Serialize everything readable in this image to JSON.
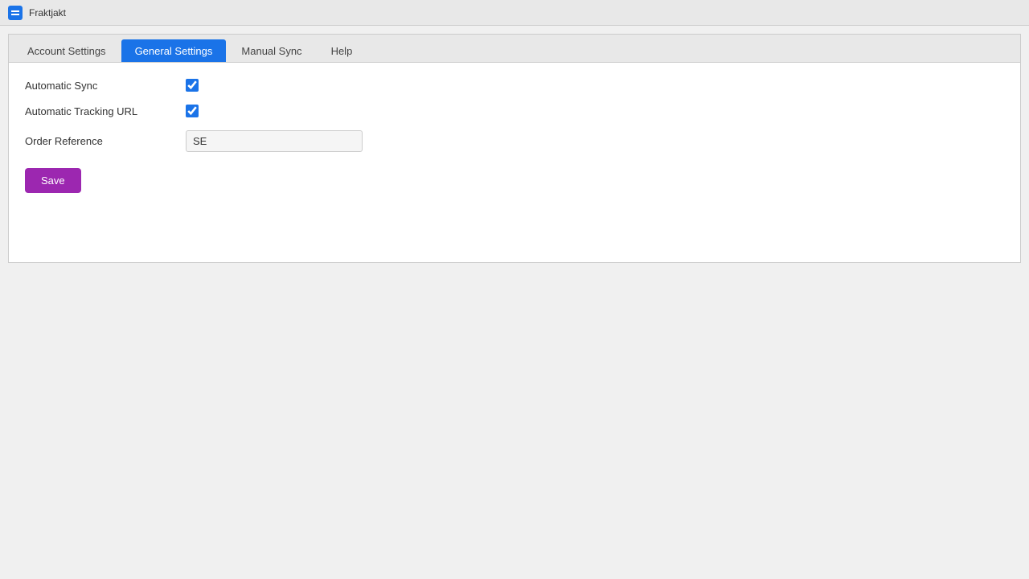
{
  "app": {
    "title": "Fraktjakt",
    "icon_label": "fraktjakt-icon"
  },
  "tabs": [
    {
      "id": "account-settings",
      "label": "Account Settings",
      "active": false
    },
    {
      "id": "general-settings",
      "label": "General Settings",
      "active": true
    },
    {
      "id": "manual-sync",
      "label": "Manual Sync",
      "active": false
    },
    {
      "id": "help",
      "label": "Help",
      "active": false
    }
  ],
  "form": {
    "automatic_sync_label": "Automatic Sync",
    "automatic_sync_checked": true,
    "automatic_tracking_url_label": "Automatic Tracking URL",
    "automatic_tracking_url_checked": true,
    "order_reference_label": "Order Reference",
    "order_reference_value": "SE",
    "save_button_label": "Save"
  }
}
